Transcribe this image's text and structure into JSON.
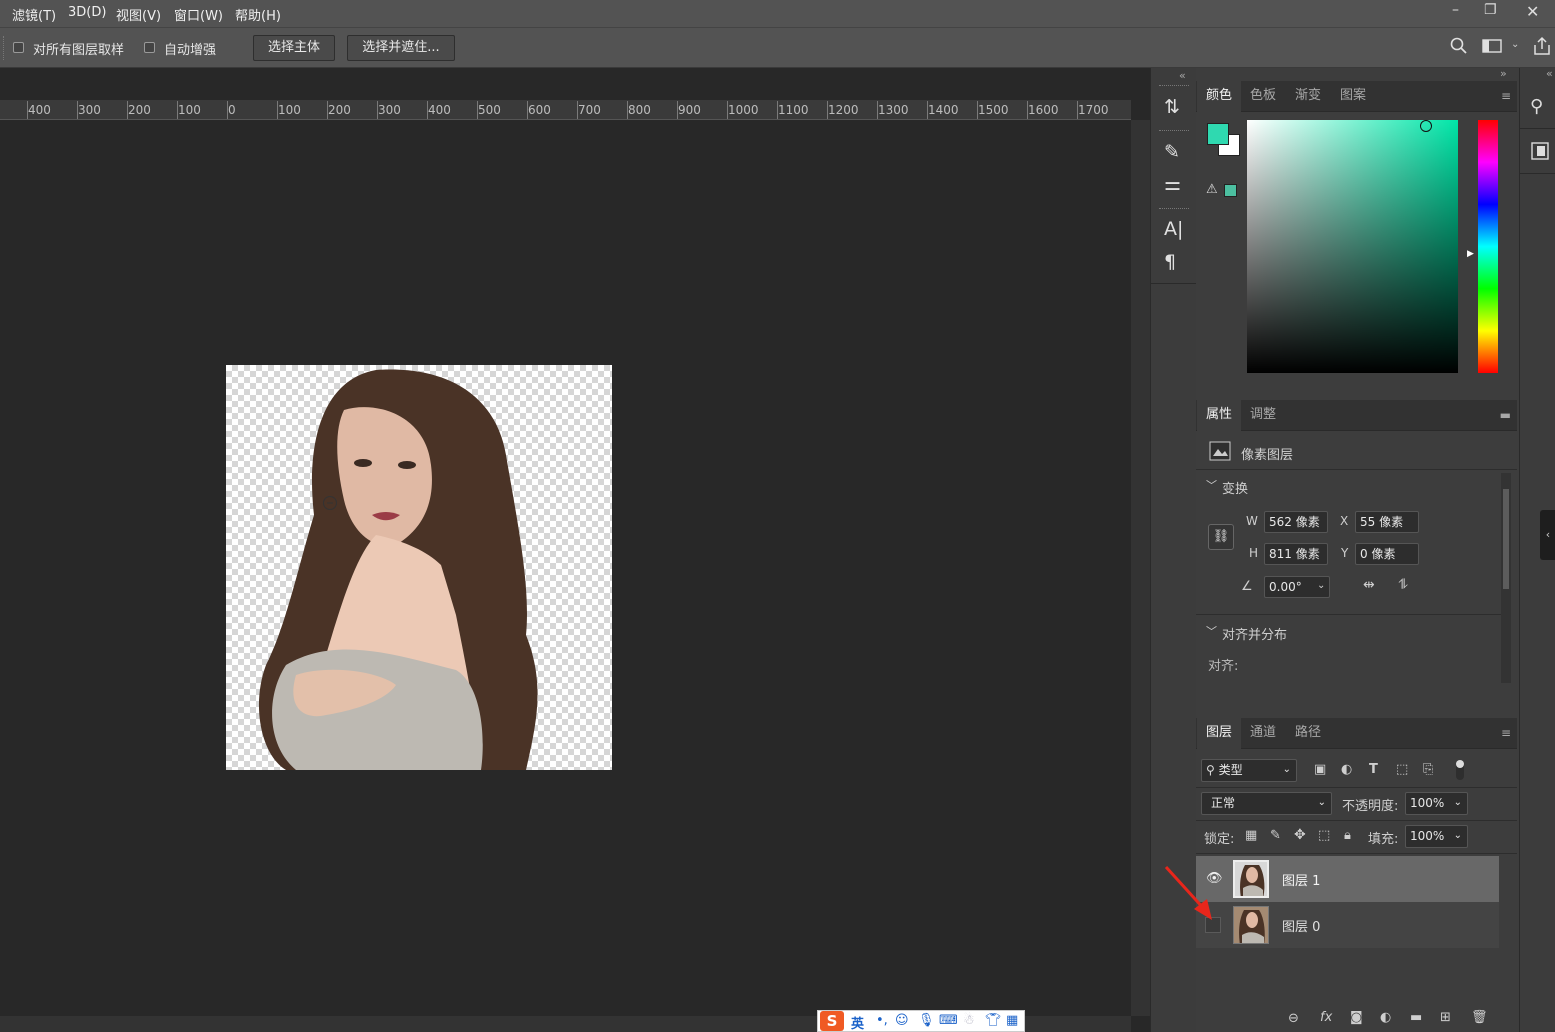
{
  "menubar": {
    "items": [
      "滤镜(T)",
      "3D(D)",
      "视图(V)",
      "窗口(W)",
      "帮助(H)"
    ]
  },
  "optionsbar": {
    "sample_all_label": "对所有图层取样",
    "auto_enhance_label": "自动增强",
    "select_subject_label": "选择主体",
    "select_mask_label": "选择并遮住..."
  },
  "ruler": {
    "ticks": [
      "400",
      "300",
      "200",
      "100",
      "0",
      "100",
      "200",
      "300",
      "400",
      "500",
      "600",
      "700",
      "800",
      "900",
      "1000",
      "1100",
      "1200",
      "1300",
      "1400",
      "1500",
      "1600",
      "1700"
    ]
  },
  "color_panel": {
    "tabs": [
      "颜色",
      "色板",
      "渐变",
      "图案"
    ],
    "foreground": "#2fd9b0",
    "background": "#ffffff"
  },
  "properties_panel": {
    "tabs": [
      "属性",
      "调整"
    ],
    "layer_type": "像素图层",
    "transform_title": "变换",
    "w_label": "W",
    "w_value": "562 像素",
    "x_label": "X",
    "x_value": "55 像素",
    "h_label": "H",
    "h_value": "811 像素",
    "y_label": "Y",
    "y_value": "0 像素",
    "angle_value": "0.00°",
    "align_title": "对齐并分布",
    "align_label": "对齐:"
  },
  "layers_panel": {
    "tabs": [
      "图层",
      "通道",
      "路径"
    ],
    "filter_kind": "类型",
    "blend_mode": "正常",
    "opacity_label": "不透明度:",
    "opacity_value": "100%",
    "lock_label": "锁定:",
    "fill_label": "填充:",
    "fill_value": "100%",
    "layers": [
      {
        "name": "图层 1",
        "visible": true,
        "selected": true
      },
      {
        "name": "图层 0",
        "visible": false,
        "selected": false
      }
    ]
  },
  "ime": {
    "mode": "英"
  }
}
